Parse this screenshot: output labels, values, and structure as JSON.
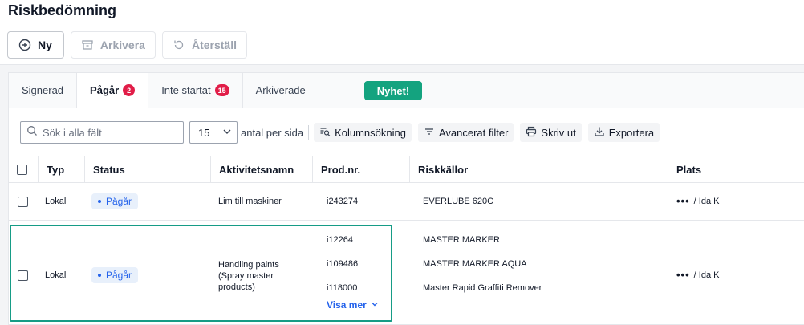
{
  "page": {
    "title": "Riskbedömning"
  },
  "toolbar": {
    "new_label": "Ny",
    "archive_label": "Arkivera",
    "restore_label": "Återställ"
  },
  "tabs": [
    {
      "label": "Signerad",
      "count": ""
    },
    {
      "label": "Pågår",
      "count": "2"
    },
    {
      "label": "Inte startat",
      "count": "15"
    },
    {
      "label": "Arkiverade",
      "count": ""
    }
  ],
  "news_button": "Nyhet!",
  "filters": {
    "search_placeholder": "Sök i alla fält",
    "page_size": "15",
    "per_page_label": "antal per sida",
    "column_search": "Kolumnsökning",
    "advanced_filter": "Avancerat filter",
    "print": "Skriv ut",
    "export": "Exportera"
  },
  "table": {
    "headers": [
      "Typ",
      "Status",
      "Aktivitetsnamn",
      "Prod.nr.",
      "Riskkällor",
      "Plats"
    ],
    "rows": [
      {
        "typ": "Lokal",
        "status": "Pågår",
        "activity": "Lim till maskiner",
        "prod": [
          "i243274"
        ],
        "risk": [
          "EVERLUBE 620C"
        ],
        "plats": "/ Ida K"
      },
      {
        "typ": "Lokal",
        "status": "Pågår",
        "activity": "Handling paints (Spray master products)",
        "prod": [
          "i12264",
          "i109486",
          "i118000"
        ],
        "risk": [
          "MASTER MARKER",
          "MASTER MARKER AQUA",
          "Master Rapid Graffiti Remover"
        ],
        "plats": "/ Ida K",
        "show_more": "Visa mer"
      }
    ]
  },
  "colors": {
    "accent": "#14a37f",
    "badge_bg": "#e8f0fb",
    "badge_fg": "#2563eb",
    "count_badge": "#e11d48",
    "highlight": "#169c86"
  }
}
